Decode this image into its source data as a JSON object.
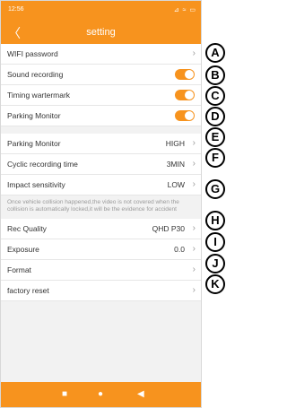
{
  "status_bar": {
    "time": "12:56",
    "icons": "⊿ ≈ ▭"
  },
  "header": {
    "title": "setting",
    "back": "〈"
  },
  "rows": {
    "wifi_password": {
      "label": "WIFI password"
    },
    "sound_recording": {
      "label": "Sound recording",
      "enabled": true
    },
    "timing_watermark": {
      "label": "Timing wartermark",
      "enabled": true
    },
    "parking_monitor_switch": {
      "label": "Parking Monitor",
      "enabled": true
    },
    "parking_monitor": {
      "label": "Parking Monitor",
      "value": "HIGH"
    },
    "cyclic_recording": {
      "label": "Cyclic recording time",
      "value": "3MIN"
    },
    "impact_sensitivity": {
      "label": "Impact sensitivity",
      "value": "LOW"
    },
    "rec_quality": {
      "label": "Rec Quality",
      "value": "QHD P30"
    },
    "exposure": {
      "label": "Exposure",
      "value": "0.0"
    },
    "format": {
      "label": "Format"
    },
    "factory_reset": {
      "label": "factory reset"
    }
  },
  "note": "Once vehicle collision happened,the video is not covered when the collision is automatically locked,it will be the evidence for accident",
  "chevron": "›",
  "navbar": {
    "home": "■",
    "circle": "●",
    "back": "◀"
  },
  "callouts": [
    "A",
    "B",
    "C",
    "D",
    "E",
    "F",
    "G",
    "H",
    "I",
    "J",
    "K"
  ],
  "colors": {
    "accent": "#f7931e"
  }
}
